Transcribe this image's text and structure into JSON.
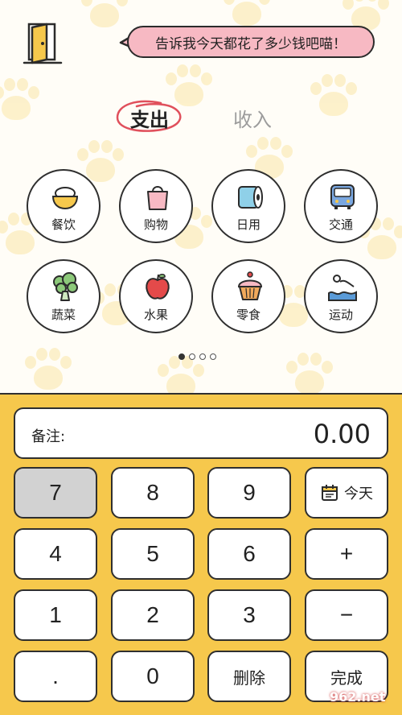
{
  "header": {
    "speech_bubble": "告诉我今天都花了多少钱吧喵！"
  },
  "tabs": {
    "expense": "支出",
    "income": "收入",
    "active": "expense"
  },
  "categories": [
    {
      "label": "餐饮",
      "icon": "rice-bowl-icon"
    },
    {
      "label": "购物",
      "icon": "shopping-bag-icon"
    },
    {
      "label": "日用",
      "icon": "toilet-paper-icon"
    },
    {
      "label": "交通",
      "icon": "bus-icon"
    },
    {
      "label": "蔬菜",
      "icon": "broccoli-icon"
    },
    {
      "label": "水果",
      "icon": "apple-icon"
    },
    {
      "label": "零食",
      "icon": "cupcake-icon"
    },
    {
      "label": "运动",
      "icon": "swimming-icon"
    }
  ],
  "pagination": {
    "pages": 4,
    "current": 1
  },
  "display": {
    "note_label": "备注:",
    "amount": "0.00"
  },
  "keypad": {
    "k7": "7",
    "k8": "8",
    "k9": "9",
    "today": "今天",
    "k4": "4",
    "k5": "5",
    "k6": "6",
    "plus": "+",
    "k1": "1",
    "k2": "2",
    "k3": "3",
    "minus": "−",
    "dot": ".",
    "k0": "0",
    "delete": "删除",
    "done": "完成"
  },
  "watermark": "962.net",
  "colors": {
    "keypad_bg": "#f6c84c",
    "bubble": "#f7b9c3",
    "paw": "#fbe7a8",
    "outline": "#2f2f2f"
  }
}
